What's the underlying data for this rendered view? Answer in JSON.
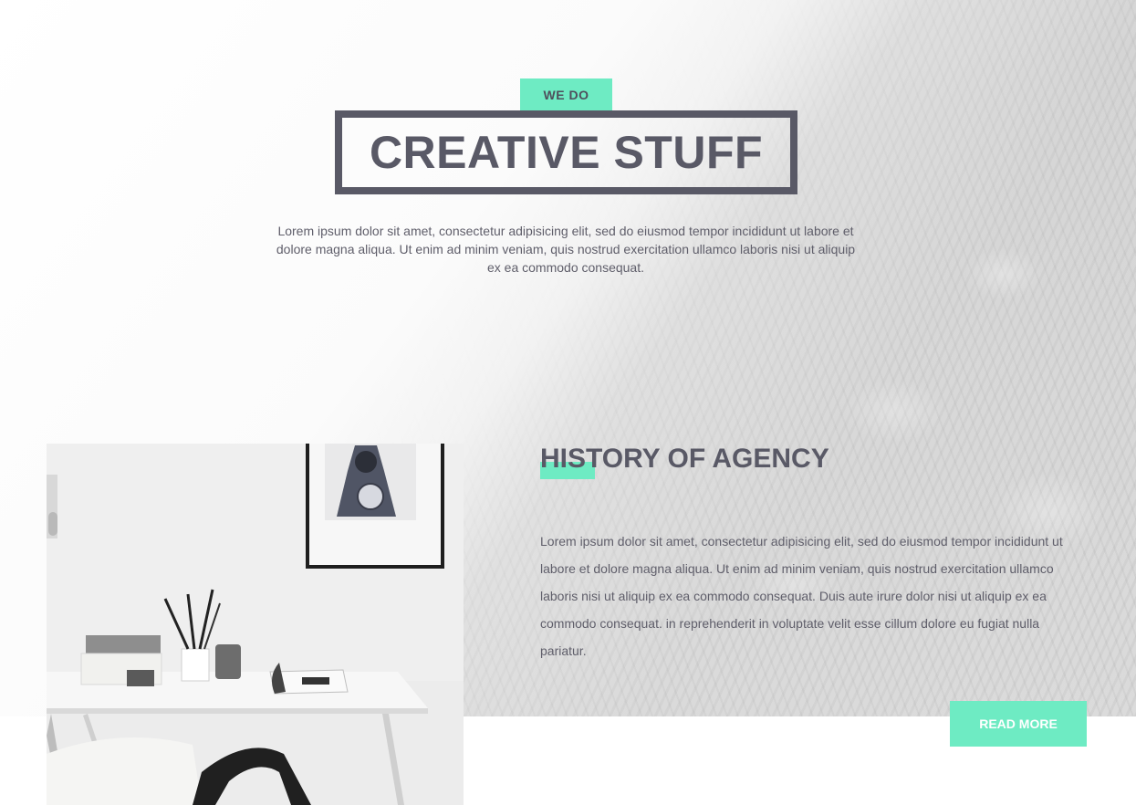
{
  "hero": {
    "tag": "WE DO",
    "title": "CREATIVE STUFF",
    "text": "Lorem ipsum dolor sit amet, consectetur adipisicing elit, sed do eiusmod tempor incididunt ut labore et dolore magna aliqua. Ut enim ad minim veniam, quis nostrud exercitation ullamco laboris nisi ut aliquip ex ea commodo consequat."
  },
  "history": {
    "title": "HISTORY OF AGENCY",
    "text": "Lorem ipsum dolor sit amet, consectetur adipisicing elit, sed do eiusmod tempor incididunt ut labore et dolore magna aliqua. Ut enim ad minim veniam, quis nostrud exercitation ullamco laboris nisi ut aliquip ex ea commodo consequat. Duis aute irure dolor nisi ut aliquip ex ea commodo consequat. in reprehenderit in voluptate velit esse cillum dolore eu fugiat nulla pariatur.",
    "button_label": "READ MORE"
  },
  "colors": {
    "accent": "#6eebc3",
    "heading": "#595966",
    "text": "#5f5e6a"
  },
  "images": {
    "background": "mountain-forest-photo",
    "workspace": "desk-workspace-photo"
  }
}
